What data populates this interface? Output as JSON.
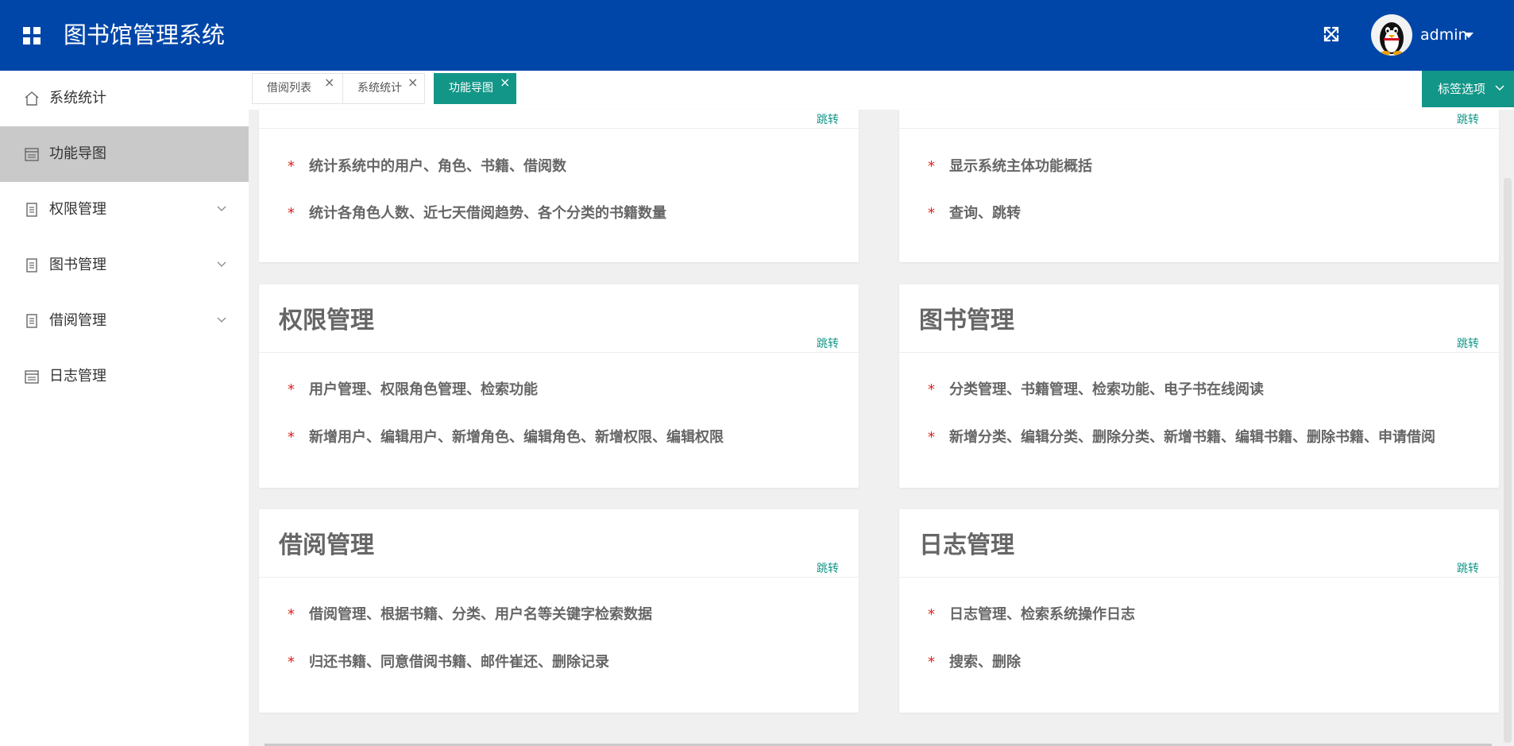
{
  "header": {
    "title": "图书馆管理系统",
    "user": "admin",
    "menu_icon": "grid-icon",
    "fullscreen_icon": "fullscreen-icon",
    "avatar_icon": "penguin-avatar"
  },
  "sidebar": {
    "items": [
      {
        "label": "系统统计",
        "icon": "home-icon",
        "has_arrow": false,
        "active": false
      },
      {
        "label": "功能导图",
        "icon": "calendar-icon",
        "has_arrow": false,
        "active": true
      },
      {
        "label": "权限管理",
        "icon": "document-icon",
        "has_arrow": true,
        "active": false
      },
      {
        "label": "图书管理",
        "icon": "document-icon",
        "has_arrow": true,
        "active": false
      },
      {
        "label": "借阅管理",
        "icon": "document-icon",
        "has_arrow": true,
        "active": false
      },
      {
        "label": "日志管理",
        "icon": "calendar-icon",
        "has_arrow": false,
        "active": false
      }
    ]
  },
  "tabs": [
    {
      "label": "借阅列表",
      "close": "×",
      "active": false
    },
    {
      "label": "系统统计",
      "close": "×",
      "active": false
    },
    {
      "label": "功能导图",
      "close": "×",
      "active": true
    }
  ],
  "tab_options": {
    "label": "标签选项"
  },
  "cards": [
    {
      "title": "",
      "link": "跳转",
      "bullets": [
        "统计系统中的用户、角色、书籍、借阅数",
        "统计各角色人数、近七天借阅趋势、各个分类的书籍数量"
      ]
    },
    {
      "title": "",
      "link": "跳转",
      "bullets": [
        "显示系统主体功能概括",
        "查询、跳转"
      ]
    },
    {
      "title": "权限管理",
      "link": "跳转",
      "bullets": [
        "用户管理、权限角色管理、检索功能",
        "新增用户、编辑用户、新增角色、编辑角色、新增权限、编辑权限"
      ]
    },
    {
      "title": "图书管理",
      "link": "跳转",
      "bullets": [
        "分类管理、书籍管理、检索功能、电子书在线阅读",
        "新增分类、编辑分类、删除分类、新增书籍、编辑书籍、删除书籍、申请借阅"
      ]
    },
    {
      "title": "借阅管理",
      "link": "跳转",
      "bullets": [
        "借阅管理、根据书籍、分类、用户名等关键字检索数据",
        "归还书籍、同意借阅书籍、邮件崔还、删除记录"
      ]
    },
    {
      "title": "日志管理",
      "link": "跳转",
      "bullets": [
        "日志管理、检索系统操作日志",
        "搜索、删除"
      ]
    }
  ],
  "bullet_marker": "*",
  "colors": {
    "header": "#0046a8",
    "accent": "#129688",
    "active_sidebar": "#c9c9c9",
    "star": "#e02020"
  }
}
